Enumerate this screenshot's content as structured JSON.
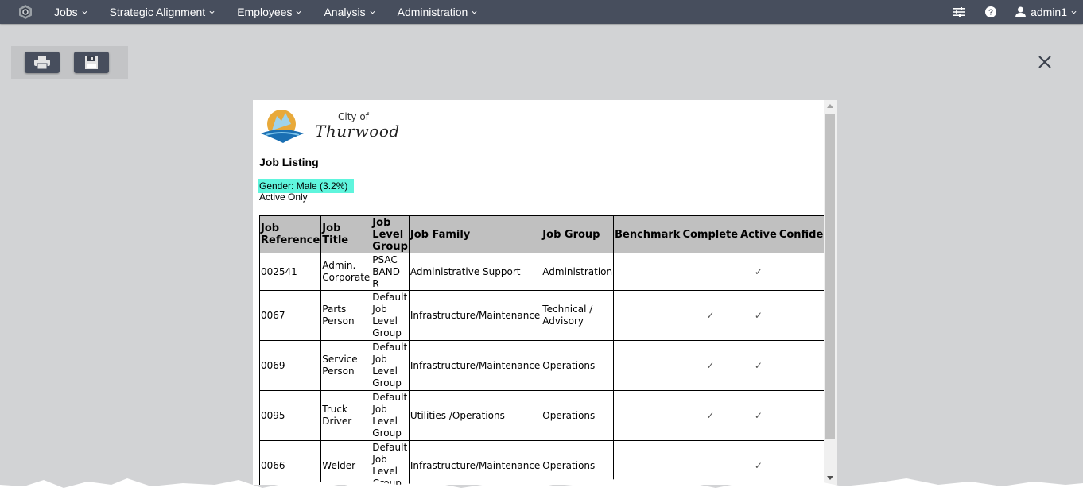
{
  "nav": {
    "items": [
      {
        "label": "Jobs"
      },
      {
        "label": "Strategic Alignment"
      },
      {
        "label": "Employees"
      },
      {
        "label": "Analysis"
      },
      {
        "label": "Administration"
      }
    ],
    "user": "admin1"
  },
  "toolbar": {
    "print_icon": "print-icon",
    "save_icon": "save-icon"
  },
  "report": {
    "logo": {
      "city_of": "City of",
      "city_name": "Thurwood"
    },
    "title": "Job Listing",
    "filter_gender": "Gender: Male (3.2%)",
    "filter_active": "Active Only",
    "highlight_color": "#5ff5dd",
    "columns": [
      "Job Reference",
      "Job Title",
      "Job Level Group",
      "Job Family",
      "Job Group",
      "Benchmark",
      "Complete",
      "Active",
      "Confidential"
    ],
    "rows": [
      {
        "ref": "002541",
        "title": "Admin. Corporate",
        "level": "PSAC BAND R",
        "family": "Administrative Support",
        "group": "Administration",
        "benchmark": "",
        "complete": "",
        "active": "✓",
        "confidential": ""
      },
      {
        "ref": "0067",
        "title": "Parts Person",
        "level": "Default Job Level Group",
        "family": "Infrastructure/Maintenance",
        "group": "Technical / Advisory",
        "benchmark": "",
        "complete": "✓",
        "active": "✓",
        "confidential": ""
      },
      {
        "ref": "0069",
        "title": "Service Person",
        "level": "Default Job Level Group",
        "family": "Infrastructure/Maintenance",
        "group": "Operations",
        "benchmark": "",
        "complete": "✓",
        "active": "✓",
        "confidential": ""
      },
      {
        "ref": "0095",
        "title": "Truck Driver",
        "level": "Default Job Level Group",
        "family": "Utilities /Operations",
        "group": "Operations",
        "benchmark": "",
        "complete": "✓",
        "active": "✓",
        "confidential": ""
      },
      {
        "ref": "0066",
        "title": "Welder",
        "level": "Default Job Level Group",
        "family": "Infrastructure/Maintenance",
        "group": "Operations",
        "benchmark": "",
        "complete": "",
        "active": "✓",
        "confidential": ""
      }
    ]
  }
}
